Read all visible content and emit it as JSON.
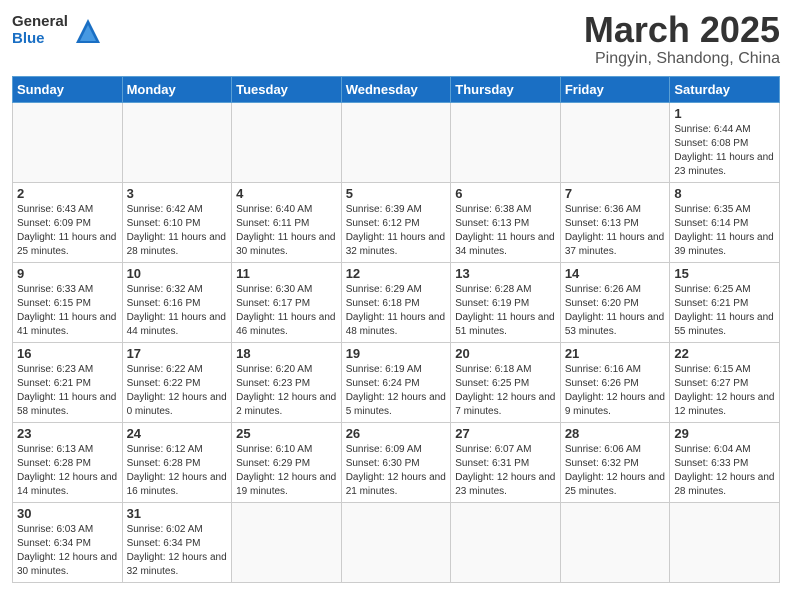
{
  "header": {
    "logo_general": "General",
    "logo_blue": "Blue",
    "month": "March 2025",
    "location": "Pingyin, Shandong, China"
  },
  "days_of_week": [
    "Sunday",
    "Monday",
    "Tuesday",
    "Wednesday",
    "Thursday",
    "Friday",
    "Saturday"
  ],
  "weeks": [
    [
      {
        "day": "",
        "info": ""
      },
      {
        "day": "",
        "info": ""
      },
      {
        "day": "",
        "info": ""
      },
      {
        "day": "",
        "info": ""
      },
      {
        "day": "",
        "info": ""
      },
      {
        "day": "",
        "info": ""
      },
      {
        "day": "1",
        "info": "Sunrise: 6:44 AM\nSunset: 6:08 PM\nDaylight: 11 hours and 23 minutes."
      }
    ],
    [
      {
        "day": "2",
        "info": "Sunrise: 6:43 AM\nSunset: 6:09 PM\nDaylight: 11 hours and 25 minutes."
      },
      {
        "day": "3",
        "info": "Sunrise: 6:42 AM\nSunset: 6:10 PM\nDaylight: 11 hours and 28 minutes."
      },
      {
        "day": "4",
        "info": "Sunrise: 6:40 AM\nSunset: 6:11 PM\nDaylight: 11 hours and 30 minutes."
      },
      {
        "day": "5",
        "info": "Sunrise: 6:39 AM\nSunset: 6:12 PM\nDaylight: 11 hours and 32 minutes."
      },
      {
        "day": "6",
        "info": "Sunrise: 6:38 AM\nSunset: 6:13 PM\nDaylight: 11 hours and 34 minutes."
      },
      {
        "day": "7",
        "info": "Sunrise: 6:36 AM\nSunset: 6:13 PM\nDaylight: 11 hours and 37 minutes."
      },
      {
        "day": "8",
        "info": "Sunrise: 6:35 AM\nSunset: 6:14 PM\nDaylight: 11 hours and 39 minutes."
      }
    ],
    [
      {
        "day": "9",
        "info": "Sunrise: 6:33 AM\nSunset: 6:15 PM\nDaylight: 11 hours and 41 minutes."
      },
      {
        "day": "10",
        "info": "Sunrise: 6:32 AM\nSunset: 6:16 PM\nDaylight: 11 hours and 44 minutes."
      },
      {
        "day": "11",
        "info": "Sunrise: 6:30 AM\nSunset: 6:17 PM\nDaylight: 11 hours and 46 minutes."
      },
      {
        "day": "12",
        "info": "Sunrise: 6:29 AM\nSunset: 6:18 PM\nDaylight: 11 hours and 48 minutes."
      },
      {
        "day": "13",
        "info": "Sunrise: 6:28 AM\nSunset: 6:19 PM\nDaylight: 11 hours and 51 minutes."
      },
      {
        "day": "14",
        "info": "Sunrise: 6:26 AM\nSunset: 6:20 PM\nDaylight: 11 hours and 53 minutes."
      },
      {
        "day": "15",
        "info": "Sunrise: 6:25 AM\nSunset: 6:21 PM\nDaylight: 11 hours and 55 minutes."
      }
    ],
    [
      {
        "day": "16",
        "info": "Sunrise: 6:23 AM\nSunset: 6:21 PM\nDaylight: 11 hours and 58 minutes."
      },
      {
        "day": "17",
        "info": "Sunrise: 6:22 AM\nSunset: 6:22 PM\nDaylight: 12 hours and 0 minutes."
      },
      {
        "day": "18",
        "info": "Sunrise: 6:20 AM\nSunset: 6:23 PM\nDaylight: 12 hours and 2 minutes."
      },
      {
        "day": "19",
        "info": "Sunrise: 6:19 AM\nSunset: 6:24 PM\nDaylight: 12 hours and 5 minutes."
      },
      {
        "day": "20",
        "info": "Sunrise: 6:18 AM\nSunset: 6:25 PM\nDaylight: 12 hours and 7 minutes."
      },
      {
        "day": "21",
        "info": "Sunrise: 6:16 AM\nSunset: 6:26 PM\nDaylight: 12 hours and 9 minutes."
      },
      {
        "day": "22",
        "info": "Sunrise: 6:15 AM\nSunset: 6:27 PM\nDaylight: 12 hours and 12 minutes."
      }
    ],
    [
      {
        "day": "23",
        "info": "Sunrise: 6:13 AM\nSunset: 6:28 PM\nDaylight: 12 hours and 14 minutes."
      },
      {
        "day": "24",
        "info": "Sunrise: 6:12 AM\nSunset: 6:28 PM\nDaylight: 12 hours and 16 minutes."
      },
      {
        "day": "25",
        "info": "Sunrise: 6:10 AM\nSunset: 6:29 PM\nDaylight: 12 hours and 19 minutes."
      },
      {
        "day": "26",
        "info": "Sunrise: 6:09 AM\nSunset: 6:30 PM\nDaylight: 12 hours and 21 minutes."
      },
      {
        "day": "27",
        "info": "Sunrise: 6:07 AM\nSunset: 6:31 PM\nDaylight: 12 hours and 23 minutes."
      },
      {
        "day": "28",
        "info": "Sunrise: 6:06 AM\nSunset: 6:32 PM\nDaylight: 12 hours and 25 minutes."
      },
      {
        "day": "29",
        "info": "Sunrise: 6:04 AM\nSunset: 6:33 PM\nDaylight: 12 hours and 28 minutes."
      }
    ],
    [
      {
        "day": "30",
        "info": "Sunrise: 6:03 AM\nSunset: 6:34 PM\nDaylight: 12 hours and 30 minutes."
      },
      {
        "day": "31",
        "info": "Sunrise: 6:02 AM\nSunset: 6:34 PM\nDaylight: 12 hours and 32 minutes."
      },
      {
        "day": "",
        "info": ""
      },
      {
        "day": "",
        "info": ""
      },
      {
        "day": "",
        "info": ""
      },
      {
        "day": "",
        "info": ""
      },
      {
        "day": "",
        "info": ""
      }
    ]
  ]
}
